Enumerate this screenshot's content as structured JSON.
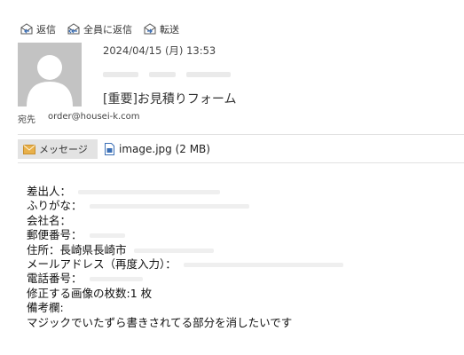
{
  "toolbar": {
    "reply": "返信",
    "reply_all": "全員に返信",
    "forward": "転送"
  },
  "header": {
    "date": "2024/04/15 (月) 13:53",
    "subject": "[重要]お見積りフォーム",
    "to_label": "宛先",
    "to_value": "order@housei-k.com"
  },
  "attachments": {
    "message_tab": "メッセージ",
    "file": "image.jpg (2 MB)"
  },
  "body": {
    "lines": [
      "差出人：",
      "ふりがな：",
      "会社名：",
      "郵便番号：",
      "住所：長崎県長崎市",
      "メールアドレス（再度入力）：",
      "電話番号：",
      "修正する画像の枚数:1 枚",
      "備考欄:",
      "マジックでいたずら書きされてる部分を消したいです"
    ]
  },
  "colors": {
    "avatar_bg": "#c3c3c3",
    "tab_bg": "#e3e3e3",
    "icon_accent": "#3b6fb6",
    "envelope": "#e8b04a"
  }
}
